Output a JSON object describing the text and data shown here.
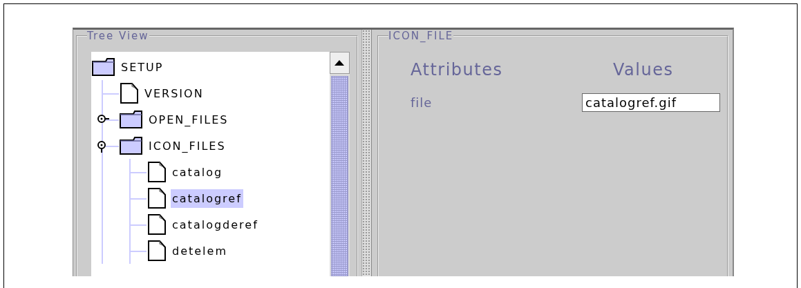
{
  "tree_panel": {
    "title": "Tree View",
    "tree": [
      {
        "label": "SETUP",
        "kind": "folder",
        "selected": false,
        "children": [
          {
            "label": "VERSION",
            "kind": "file",
            "selected": false
          },
          {
            "label": "OPEN_FILES",
            "kind": "folder",
            "expanded": false,
            "selected": false
          },
          {
            "label": "ICON_FILES",
            "kind": "folder",
            "expanded": true,
            "selected": false,
            "children": [
              {
                "label": "catalog",
                "kind": "file",
                "selected": false
              },
              {
                "label": "catalogref",
                "kind": "file",
                "selected": true
              },
              {
                "label": "catalogderef",
                "kind": "file",
                "selected": false
              },
              {
                "label": "detelem",
                "kind": "file",
                "selected": false
              }
            ]
          }
        ]
      }
    ]
  },
  "detail_panel": {
    "title": "ICON_FILE",
    "headers": [
      "Attributes",
      "Values"
    ],
    "rows": [
      {
        "attribute": "file",
        "value": "catalogref.gif"
      }
    ]
  }
}
